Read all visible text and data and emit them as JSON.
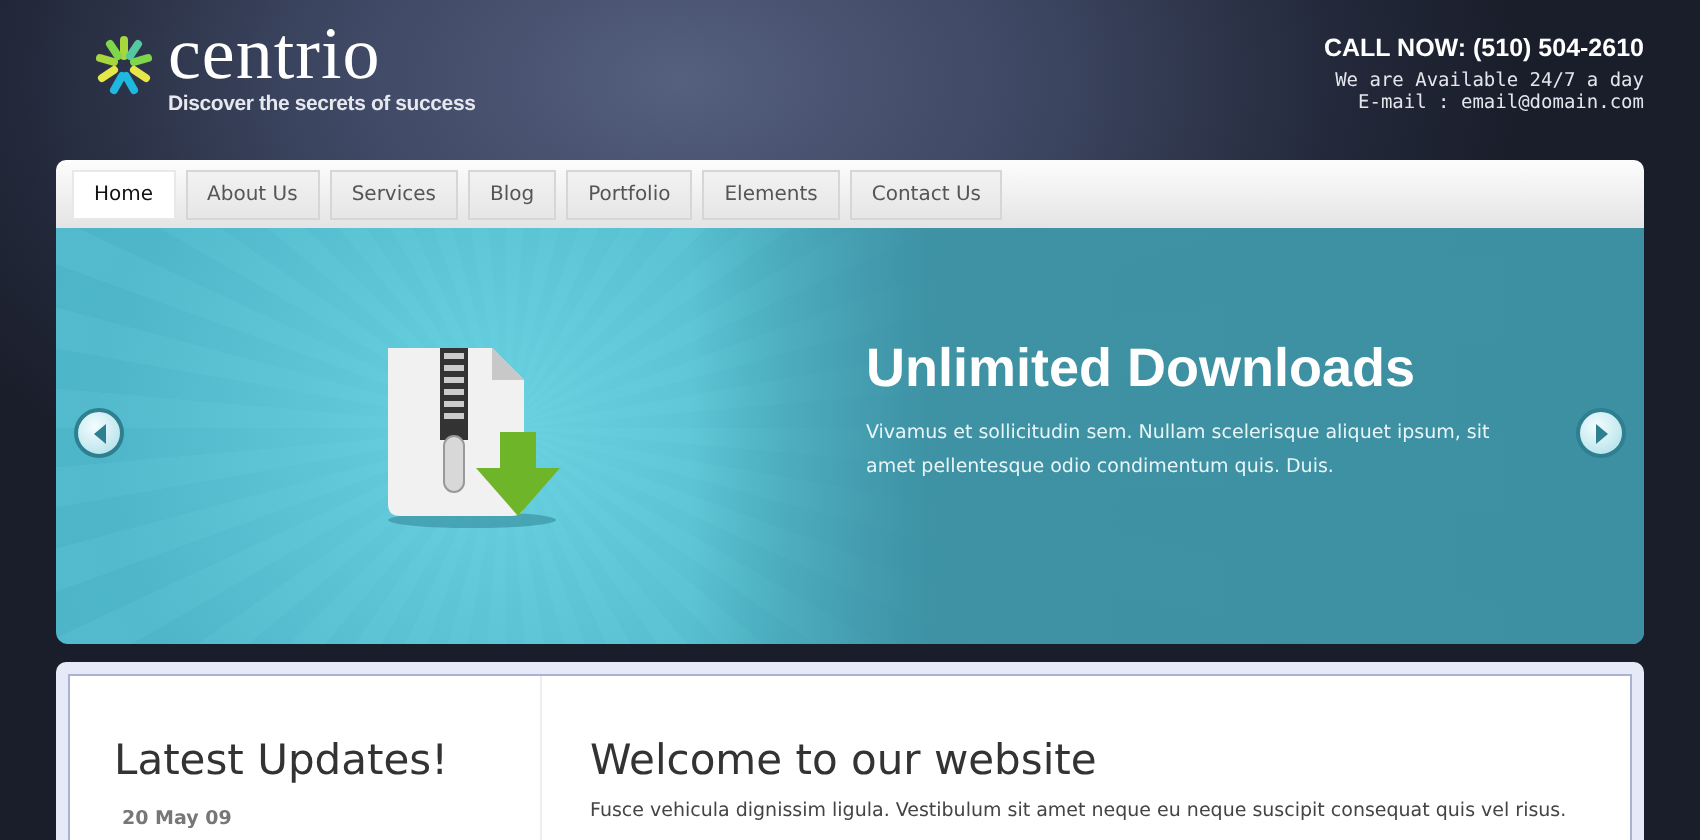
{
  "logo": {
    "name": "centrio",
    "tagline": "Discover the secrets of success"
  },
  "contact": {
    "call": "CALL NOW: (510) 504-2610",
    "availability": "We are Available 24/7 a day",
    "email": "E-mail : email@domain.com"
  },
  "nav": [
    {
      "label": "Home",
      "selected": true
    },
    {
      "label": "About Us",
      "selected": false
    },
    {
      "label": "Services",
      "selected": false
    },
    {
      "label": "Blog",
      "selected": false
    },
    {
      "label": "Portfolio",
      "selected": false
    },
    {
      "label": "Elements",
      "selected": false
    },
    {
      "label": "Contact Us",
      "selected": false
    }
  ],
  "slide": {
    "title": "Unlimited Downloads",
    "text": "Vivamus et sollicitudin sem. Nullam scelerisque aliquet ipsum, sit amet pellentesque odio condimentum quis. Duis."
  },
  "updates": {
    "title": "Latest Updates!",
    "date": "20 May 09"
  },
  "welcome": {
    "title": "Welcome to our website",
    "text": "Fusce vehicula dignissim ligula. Vestibulum sit amet neque eu neque suscipit consequat quis vel risus."
  }
}
